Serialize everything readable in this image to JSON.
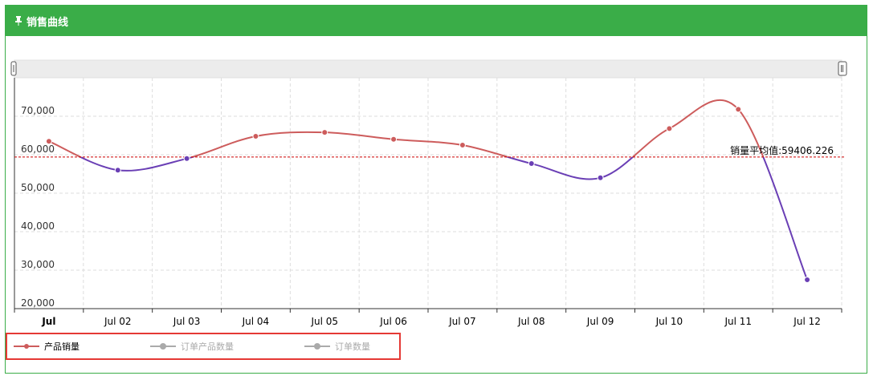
{
  "panel": {
    "title": "销售曲线",
    "title_icon": "pin-icon",
    "header_color": "#3aad48"
  },
  "chart_data": {
    "type": "line",
    "categories": [
      "Jul",
      "Jul 02",
      "Jul 03",
      "Jul 04",
      "Jul 05",
      "Jul 06",
      "Jul 07",
      "Jul 08",
      "Jul 09",
      "Jul 10",
      "Jul 11",
      "Jul 12"
    ],
    "ylim": [
      20000,
      80000
    ],
    "yticks": [
      20000,
      30000,
      40000,
      50000,
      60000,
      70000
    ],
    "ytick_labels": [
      "20,000",
      "30,000",
      "40,000",
      "50,000",
      "60,000",
      "70,000"
    ],
    "grid": true,
    "series": [
      {
        "name": "产品销量",
        "values": [
          63500,
          56000,
          59000,
          64800,
          65800,
          64000,
          62500,
          57700,
          54000,
          66800,
          71800,
          27500
        ],
        "color": "#cd5c5c",
        "below_average_color": "#6a3fb5",
        "visible": true
      },
      {
        "name": "订单产品数量",
        "visible": false,
        "color": "#aaaaaa"
      },
      {
        "name": "订单数量",
        "visible": false,
        "color": "#aaaaaa"
      }
    ],
    "average": {
      "value": 59406.226,
      "label": "销量平均值:59406.226",
      "color": "#cc0000"
    },
    "legend_position": "bottom-left"
  }
}
